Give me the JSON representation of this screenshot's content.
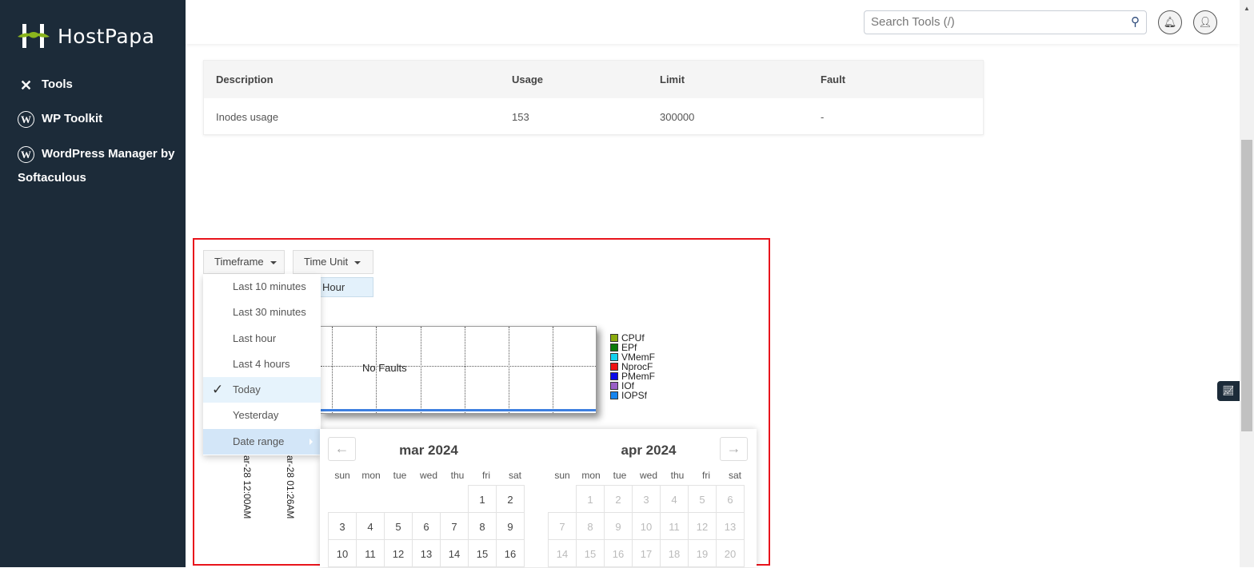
{
  "brand": {
    "name": "HostPapa",
    "accent": "#8bb51d",
    "sidebar_bg": "#1c2b39"
  },
  "sidebar": {
    "items": [
      {
        "label": "Tools",
        "icon": "tools-icon"
      },
      {
        "label": "WP Toolkit",
        "icon": "wordpress-icon"
      },
      {
        "label": "WordPress Manager by Softaculous",
        "icon": "wordpress-icon"
      }
    ]
  },
  "header": {
    "search_placeholder": "Search Tools (/)",
    "icons": [
      "search-icon",
      "bell-icon",
      "user-icon"
    ]
  },
  "table": {
    "columns": [
      "Description",
      "Usage",
      "Limit",
      "Fault"
    ],
    "rows": [
      [
        "Inodes usage",
        "153",
        "300000",
        "-"
      ]
    ]
  },
  "controls": {
    "timeframe_label": "Timeframe",
    "time_unit_label": "Time Unit",
    "time_unit_value": "Hour"
  },
  "timeframe_menu": {
    "items": [
      "Last 10 minutes",
      "Last 30 minutes",
      "Last hour",
      "Last 4 hours",
      "Today",
      "Yesterday",
      "Date range"
    ],
    "selected": "Today"
  },
  "chart": {
    "message": "No Faults",
    "legend": [
      {
        "name": "CPUf",
        "color": "#8aab0e"
      },
      {
        "name": "EPf",
        "color": "#0b7a0b"
      },
      {
        "name": "VMemF",
        "color": "#14d0ef"
      },
      {
        "name": "NprocF",
        "color": "#ee1111"
      },
      {
        "name": "PMemF",
        "color": "#0a0ae8"
      },
      {
        "name": "IOf",
        "color": "#9a5fc6"
      },
      {
        "name": "IOPSf",
        "color": "#1684ee"
      }
    ],
    "x_labels": [
      "ar-28 12:00AM",
      "ar-28 01:26AM"
    ]
  },
  "calendar": {
    "weekdays": [
      "sun",
      "mon",
      "tue",
      "wed",
      "thu",
      "fri",
      "sat"
    ],
    "months": [
      {
        "title": "mar 2024",
        "weeks": [
          [
            null,
            null,
            null,
            null,
            null,
            1,
            2
          ],
          [
            3,
            4,
            5,
            6,
            7,
            8,
            9
          ],
          [
            10,
            11,
            12,
            13,
            14,
            15,
            16
          ]
        ],
        "disabled": false
      },
      {
        "title": "apr 2024",
        "weeks": [
          [
            null,
            1,
            2,
            3,
            4,
            5,
            6
          ],
          [
            7,
            8,
            9,
            10,
            11,
            12,
            13
          ],
          [
            14,
            15,
            16,
            17,
            18,
            19,
            20
          ]
        ],
        "disabled": true
      }
    ]
  }
}
